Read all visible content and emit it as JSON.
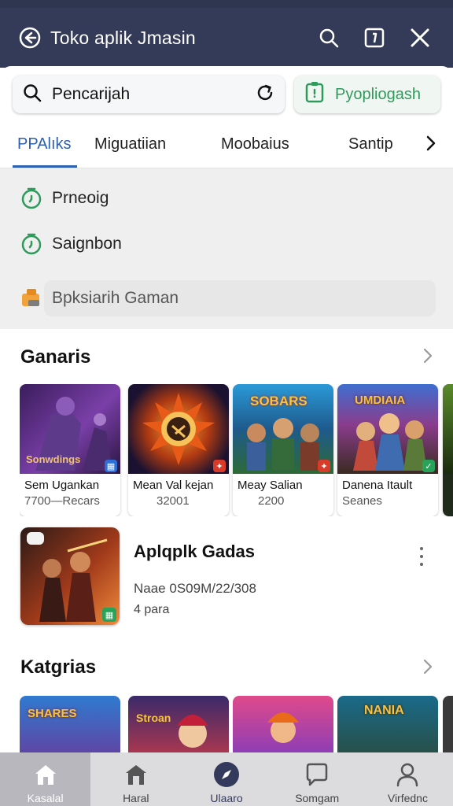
{
  "app": {
    "title": "Toko aplik Jmasin"
  },
  "colors": {
    "topbar": "#343b58",
    "accent": "#2d5fb0",
    "green": "#2f9a5c"
  },
  "search": {
    "value": "Pencarijah",
    "button_label": "Pyopliogash"
  },
  "tabs": [
    {
      "label": "PPAlıks",
      "active": true
    },
    {
      "label": "Miguatiian"
    },
    {
      "label": "Moobaius"
    },
    {
      "label": "Santip"
    }
  ],
  "suggestions": [
    {
      "label": "Prneoig",
      "icon": "clock-icon"
    },
    {
      "label": "Saignbon",
      "icon": "clock-icon"
    }
  ],
  "history": {
    "label": "Bpksiarih Gaman",
    "icon": "history-icon"
  },
  "sections": {
    "games": "Ganaris",
    "categories": "Katgrias"
  },
  "game_cards": [
    {
      "name": "Sem Ugankan",
      "sub": "7700—Recars",
      "art_text": "Sonwdings",
      "badge_color": "#2d6fd8"
    },
    {
      "name": "Mean Val kejan",
      "sub": "32001",
      "art_text": "",
      "badge_color": "#d93b2b"
    },
    {
      "name": "Meay Salian",
      "sub": "2200",
      "art_text": "SOBARS",
      "badge_color": "#d93b2b"
    },
    {
      "name": "Danena Itault",
      "sub": "Seanes",
      "art_text": "UMDIAIA",
      "badge_color": "#27a35a"
    }
  ],
  "featured": {
    "title": "Aplqplk Gadas",
    "sub1": "Naae 0S09M/22/308",
    "sub2": "4 para"
  },
  "category_cards": [
    {
      "art_text": "SHARES"
    },
    {
      "art_text": "Stroan"
    },
    {
      "art_text": ""
    },
    {
      "art_text": "NANIA"
    }
  ],
  "bottom_nav": [
    {
      "label": "Kasalal",
      "icon": "home-icon"
    },
    {
      "label": "Haral",
      "icon": "store-icon"
    },
    {
      "label": "Ulaaro",
      "icon": "compass-icon"
    },
    {
      "label": "Somgam",
      "icon": "chat-icon"
    },
    {
      "label": "Virfednc",
      "icon": "profile-icon"
    }
  ]
}
